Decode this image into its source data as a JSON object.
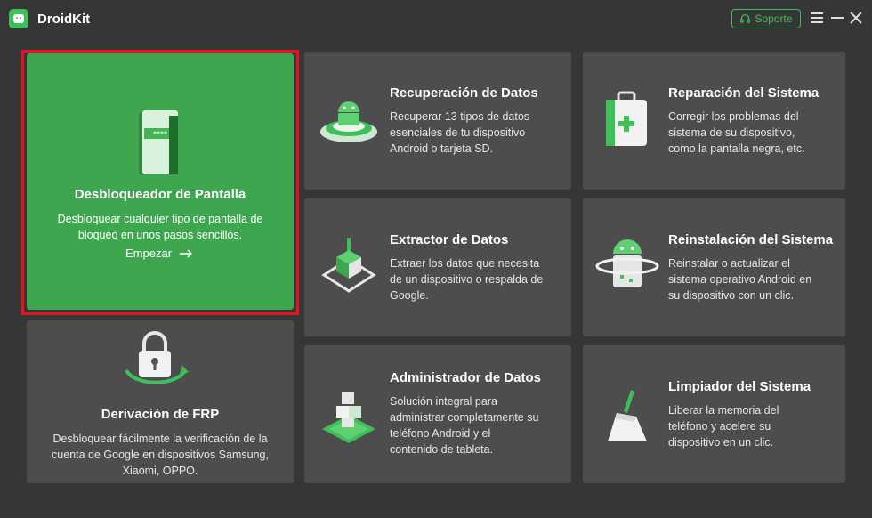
{
  "app": {
    "title": "DroidKit"
  },
  "toolbar": {
    "support_label": "Soporte"
  },
  "hero": {
    "title": "Desbloqueador de Pantalla",
    "desc_line1": "Desbloquear cualquier tipo de pantalla de",
    "desc_line2": "bloqueo en unos pasos sencillos.",
    "action_label": "Empezar"
  },
  "frp": {
    "title": "Derivación de FRP",
    "desc_line1": "Desbloquear fácilmente la verificación de la",
    "desc_line2": "cuenta de Google en dispositivos Samsung,",
    "desc_line3": "Xiaomi, OPPO."
  },
  "cards": [
    {
      "title": "Recuperación de Datos",
      "lines": [
        "Recuperar 13 tipos de datos",
        "esenciales de tu dispositivo",
        "Android o tarjeta SD."
      ]
    },
    {
      "title": "Reparación del Sistema",
      "lines": [
        "Corregir los problemas del",
        "sistema de su dispositivo,",
        "como la pantalla negra, etc."
      ]
    },
    {
      "title": "Extractor de Datos",
      "lines": [
        "Extraer los datos que necesita",
        "de un dispositivo o respalda de",
        "Google."
      ]
    },
    {
      "title": "Reinstalación del Sistema",
      "lines": [
        "Reinstalar o actualizar el",
        "sistema operativo Android en",
        "su dispositivo con un clic."
      ]
    },
    {
      "title": "Administrador de Datos",
      "lines": [
        "Solución integral para",
        "administrar completamente su",
        "teléfono Android y el",
        "contenido de tableta."
      ]
    },
    {
      "title": "Limpiador del Sistema",
      "lines": [
        "Liberar la memoria del",
        "teléfono y acelere su",
        "dispositivo en un clic."
      ]
    }
  ],
  "icons": {
    "app_logo": "droidkit-logo-icon",
    "support": "headset-icon",
    "menu": "hamburger-icon",
    "minimize": "minimize-icon",
    "close": "close-icon"
  },
  "colors": {
    "accent": "#3fbf59",
    "hero_bg": "#3ea64f",
    "card_bg": "#4d4d4d",
    "window_bg": "#363636",
    "highlight": "#e8121e"
  }
}
